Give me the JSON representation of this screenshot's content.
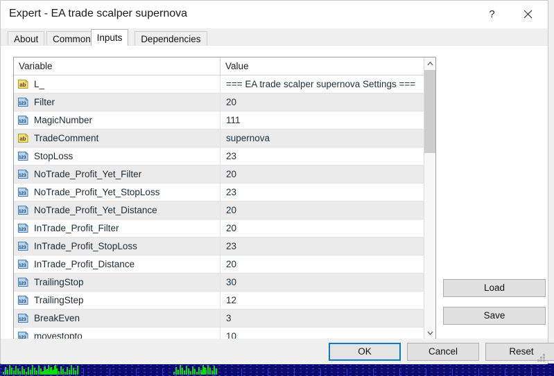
{
  "window": {
    "title": "Expert - EA trade scalper supernova",
    "help_icon": "question-mark-icon",
    "close_icon": "close-x-icon"
  },
  "tabs": [
    {
      "label": "About",
      "active": false
    },
    {
      "label": "Common",
      "active": false
    },
    {
      "label": "Inputs",
      "active": true
    },
    {
      "label": "Dependencies",
      "active": false
    }
  ],
  "table": {
    "columns": [
      "Variable",
      "Value"
    ],
    "rows": [
      {
        "icon": "string-type-icon",
        "variable": "L_",
        "value": "=== EA trade scalper supernova Settings ==="
      },
      {
        "icon": "number-type-icon",
        "variable": "Filter",
        "value": "20"
      },
      {
        "icon": "number-type-icon",
        "variable": "MagicNumber",
        "value": "111"
      },
      {
        "icon": "string-type-icon",
        "variable": "TradeComment",
        "value": "supernova"
      },
      {
        "icon": "number-type-icon",
        "variable": "StopLoss",
        "value": "23"
      },
      {
        "icon": "number-type-icon",
        "variable": "NoTrade_Profit_Yet_Filter",
        "value": "20"
      },
      {
        "icon": "number-type-icon",
        "variable": "NoTrade_Profit_Yet_StopLoss",
        "value": "23"
      },
      {
        "icon": "number-type-icon",
        "variable": "NoTrade_Profit_Yet_Distance",
        "value": "20"
      },
      {
        "icon": "number-type-icon",
        "variable": "InTrade_Profit_Filter",
        "value": "20"
      },
      {
        "icon": "number-type-icon",
        "variable": "InTrade_Profit_StopLoss",
        "value": "23"
      },
      {
        "icon": "number-type-icon",
        "variable": "InTrade_Profit_Distance",
        "value": "20"
      },
      {
        "icon": "number-type-icon",
        "variable": "TrailingStop",
        "value": "30"
      },
      {
        "icon": "number-type-icon",
        "variable": "TrailingStep",
        "value": "12"
      },
      {
        "icon": "number-type-icon",
        "variable": "BreakEven",
        "value": "3"
      },
      {
        "icon": "number-type-icon",
        "variable": "movestopto",
        "value": "10"
      }
    ]
  },
  "scrollbar": {
    "up_icon": "chevron-up-icon",
    "down_icon": "chevron-down-icon"
  },
  "side_buttons": {
    "load": "Load",
    "save": "Save"
  },
  "footer_buttons": {
    "ok": "OK",
    "cancel": "Cancel",
    "reset": "Reset"
  },
  "colors": {
    "accent": "#0d7ac4",
    "string_icon": "#e8c54a",
    "number_icon": "#6fa8dc",
    "chart_background": "#0a0a6e",
    "chart_candle": "#00e000"
  }
}
